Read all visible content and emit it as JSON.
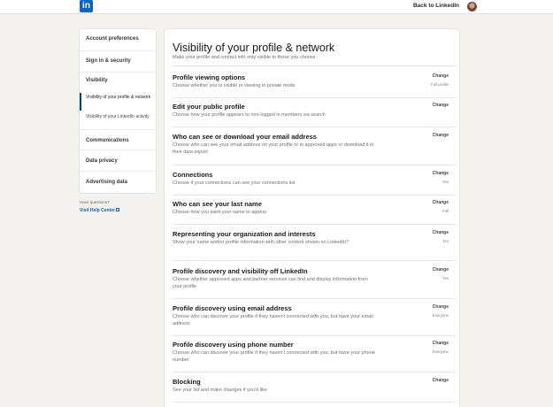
{
  "header": {
    "logo_text": "in",
    "back_link": "Back to LinkedIn"
  },
  "sidebar": {
    "items": [
      {
        "label": "Account preferences"
      },
      {
        "label": "Sign in & security"
      },
      {
        "label": "Visibility"
      },
      {
        "label": "Visibility of your profile & network",
        "active": true
      },
      {
        "label": "Visibility of your LinkedIn activity"
      },
      {
        "label": "Communications"
      },
      {
        "label": "Data privacy"
      },
      {
        "label": "Advertising data"
      }
    ],
    "help_question": "Have questions?",
    "help_link": "Visit Help Center"
  },
  "main": {
    "title": "Visibility of your profile & network",
    "subtitle": "Make your profile and contact info only visible to those you choose",
    "change_label": "Change",
    "settings": [
      {
        "title": "Profile viewing options",
        "desc": "Choose whether you're visible or viewing in private mode",
        "value": "Full profile"
      },
      {
        "title": "Edit your public profile",
        "desc": "Choose how your profile appears to non-logged in members via search",
        "value": ""
      },
      {
        "title": "Who can see or download your email address",
        "desc": "Choose who can see your email address on your profile or in approved apps or download it in their data export",
        "value": ""
      },
      {
        "title": "Connections",
        "desc": "Choose if your connections can see your connections list",
        "value": "Yes"
      },
      {
        "title": "Who can see your last name",
        "desc": "Choose how you want your name to appear",
        "value": "Full"
      },
      {
        "title": "Representing your organization and interests",
        "desc": "Show your name and/or profile information with other content shown on LinkedIn?",
        "value": "Yes"
      },
      {
        "title": "Profile discovery and visibility off LinkedIn",
        "desc": "Choose whether approved apps and partner services can find and display information from your profile",
        "value": "Yes"
      },
      {
        "title": "Profile discovery using email address",
        "desc": "Choose who can discover your profile if they haven't connected with you, but have your email address",
        "value": "Everyone"
      },
      {
        "title": "Profile discovery using phone number",
        "desc": "Choose who can discover your profile if they haven't connected with you, but have your phone number",
        "value": "Everyone"
      },
      {
        "title": "Blocking",
        "desc": "See your list and make changes if you'd like",
        "value": ""
      }
    ]
  }
}
